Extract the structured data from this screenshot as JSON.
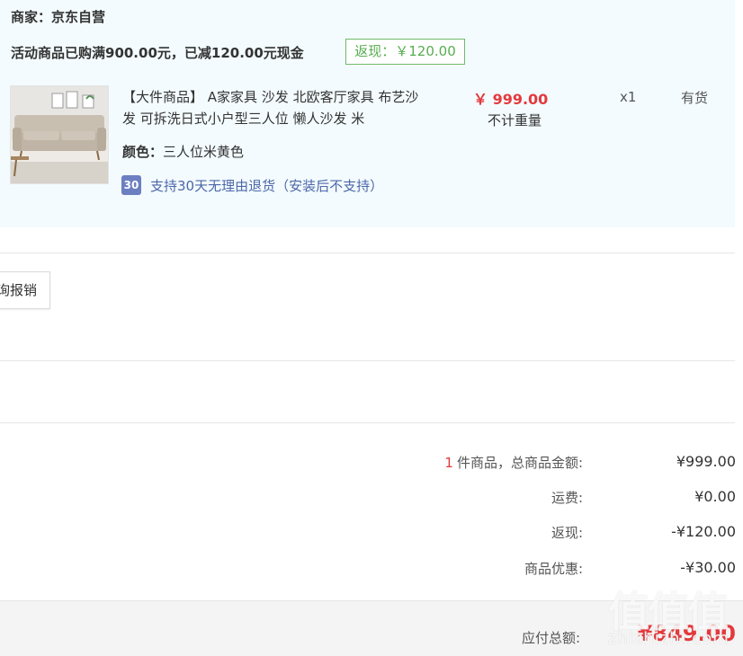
{
  "store": {
    "merchant": "商家：京东自营",
    "promo": "活动商品已购满900.00元，已减120.00元现金",
    "cashback_tag": "返现：￥120.00"
  },
  "product": {
    "title": "【大件商品】 A家家具 沙发 北欧客厅家具 布艺沙发 可拆洗日式小户型三人位 懒人沙发 米",
    "color_label": "颜色：",
    "color_value": "三人位米黄色",
    "return_badge": "30",
    "return_policy": "支持30天无理由退货（安装后不支持）",
    "price": "￥ 999.00",
    "weight_note": "不计重量",
    "quantity": "x1",
    "stock": "有货"
  },
  "report_button": "询报销",
  "summary": {
    "item_count": "1",
    "items_label": "件商品，总商品金额:",
    "items_total": "¥999.00",
    "shipping_label": "运费:",
    "shipping": "¥0.00",
    "cashback_label": "返现:",
    "cashback": "-¥120.00",
    "discount_label": "商品优惠:",
    "discount": "-¥30.00",
    "payable_label": "应付总额:",
    "payable": "¥849.00"
  },
  "watermark": {
    "logo_text": "值值值",
    "site": "zhizhizhi.com"
  },
  "colors": {
    "accent_red": "#e4393c",
    "cashback_green": "#58ad52",
    "store_bg": "#f3fbfe",
    "link_blue": "#4d67a8"
  }
}
